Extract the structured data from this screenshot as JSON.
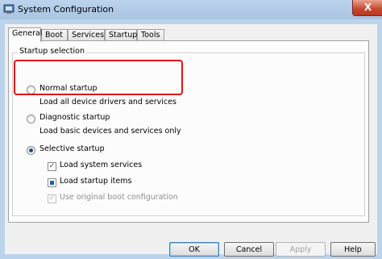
{
  "window": {
    "title": "System Configuration",
    "close_glyph": "X"
  },
  "tabs": [
    {
      "label": "General",
      "active": true
    },
    {
      "label": "Boot",
      "active": false
    },
    {
      "label": "Services",
      "active": false
    },
    {
      "label": "Startup",
      "active": false
    },
    {
      "label": "Tools",
      "active": false
    }
  ],
  "startup_selection": {
    "group_label": "Startup selection",
    "normal": {
      "label": "Normal startup",
      "description": "Load all device drivers and services",
      "selected": false
    },
    "diagnostic": {
      "label": "Diagnostic startup",
      "description": "Load basic devices and services only",
      "selected": false
    },
    "selective": {
      "label": "Selective startup",
      "selected": true,
      "options": [
        {
          "label": "Load system services",
          "state": "checked"
        },
        {
          "label": "Load startup items",
          "state": "partial"
        },
        {
          "label": "Use original boot configuration",
          "state": "checked-disabled"
        }
      ]
    }
  },
  "buttons": {
    "ok": "OK",
    "cancel": "Cancel",
    "apply": "Apply",
    "help": "Help"
  },
  "colors": {
    "highlight": "#e0141a",
    "titlebar": "#bcd3ec",
    "close": "#c8452c"
  }
}
